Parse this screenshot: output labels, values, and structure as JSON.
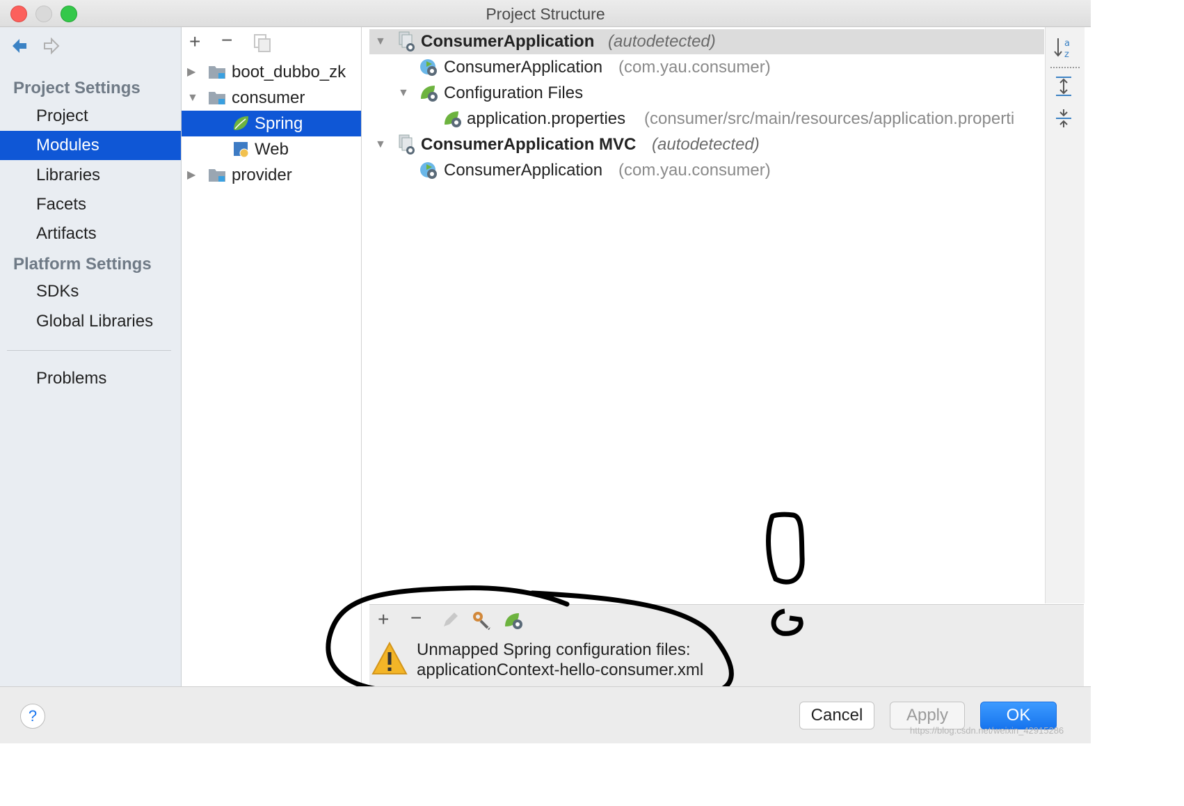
{
  "window": {
    "title": "Project Structure"
  },
  "sidebar": {
    "project_settings_heading": "Project Settings",
    "platform_settings_heading": "Platform Settings",
    "items": [
      {
        "label": "Project"
      },
      {
        "label": "Modules",
        "selected": true
      },
      {
        "label": "Libraries"
      },
      {
        "label": "Facets"
      },
      {
        "label": "Artifacts"
      },
      {
        "label": "SDKs"
      },
      {
        "label": "Global Libraries"
      },
      {
        "label": "Problems"
      }
    ]
  },
  "tree": {
    "items": [
      {
        "label": "boot_dubbo_zk",
        "expanded": false
      },
      {
        "label": "consumer",
        "expanded": true
      },
      {
        "label": "Spring",
        "selected": true
      },
      {
        "label": "Web"
      },
      {
        "label": "provider",
        "expanded": false
      }
    ]
  },
  "spring_panel": {
    "groups": [
      {
        "name": "ConsumerApplication",
        "suffix": "(autodetected)",
        "children": [
          {
            "name": "ConsumerApplication",
            "detail": "(com.yau.consumer)"
          },
          {
            "name": "Configuration Files"
          },
          {
            "name": "application.properties",
            "detail": "(consumer/src/main/resources/application.properti"
          }
        ]
      },
      {
        "name": "ConsumerApplication MVC",
        "suffix": "(autodetected)",
        "children": [
          {
            "name": "ConsumerApplication",
            "detail": "(com.yau.consumer)"
          }
        ]
      }
    ]
  },
  "warning": {
    "line1": "Unmapped Spring configuration files:",
    "line2": "applicationContext-hello-consumer.xml"
  },
  "footer": {
    "cancel": "Cancel",
    "apply": "Apply",
    "ok": "OK",
    "help": "?",
    "watermark": "https://blog.csdn.net/weixin_42915286"
  },
  "colors": {
    "selection": "#0f57d6",
    "spring_green": "#6db33f",
    "sidebar_bg": "#e9edf2"
  }
}
